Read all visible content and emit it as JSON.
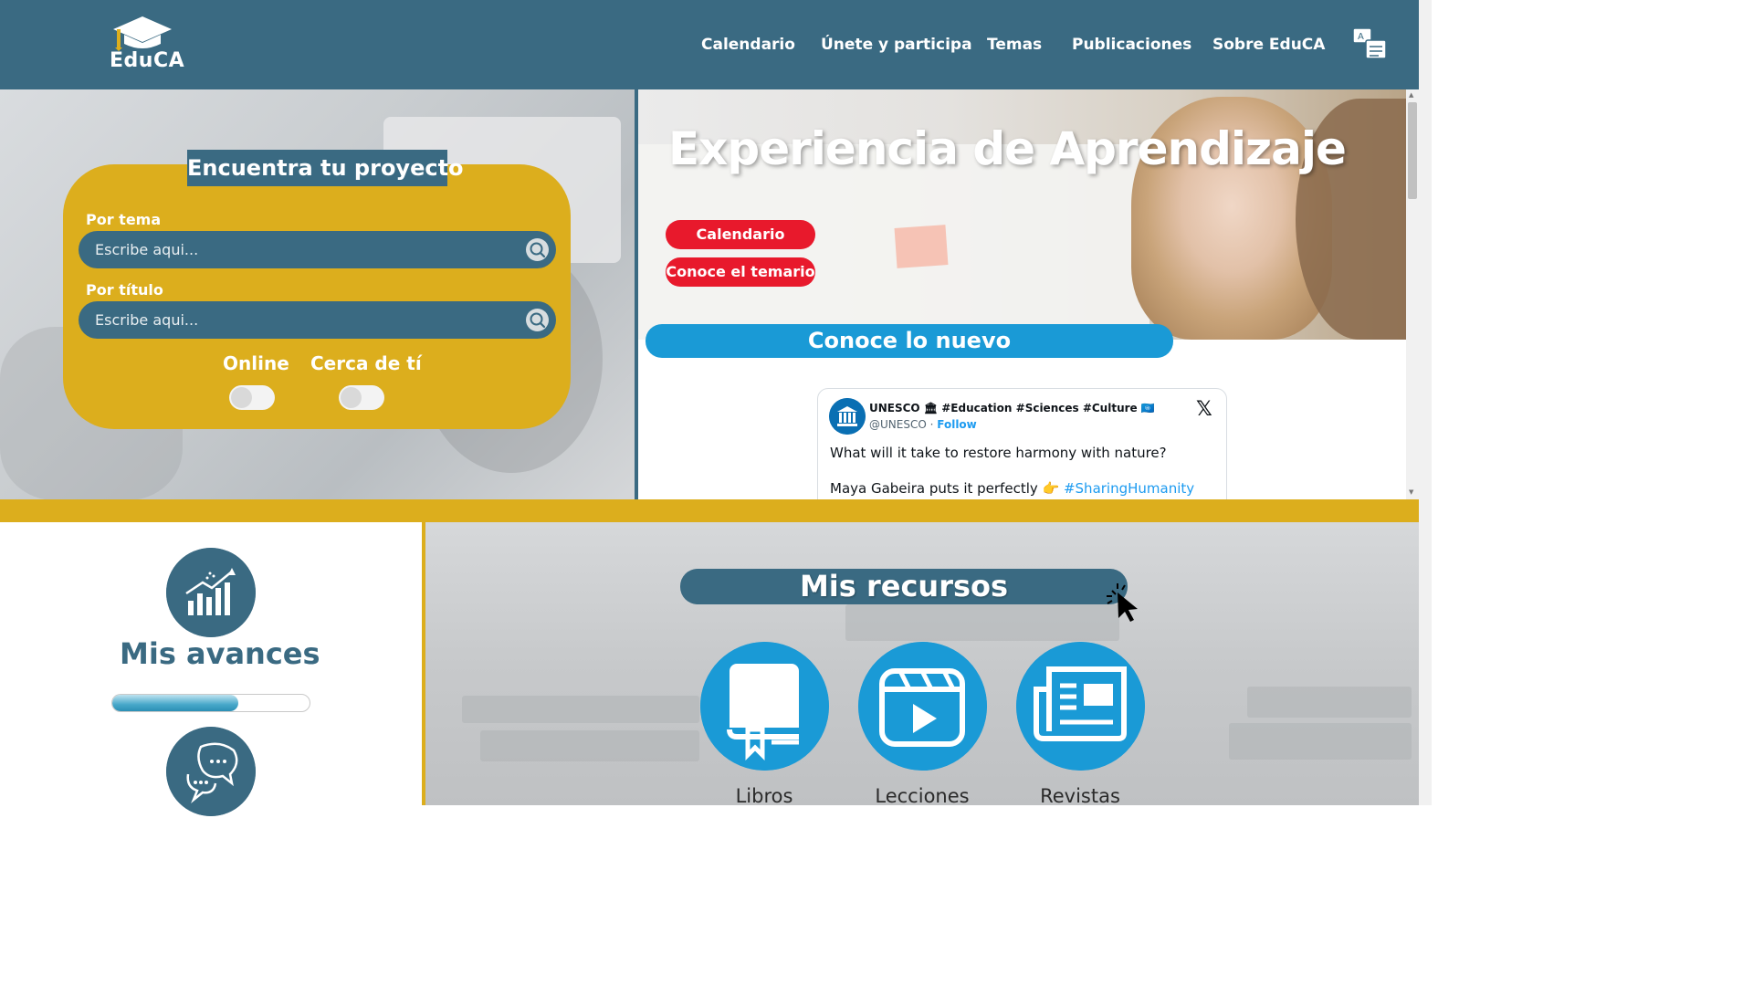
{
  "header": {
    "logo_text": "EduCA",
    "nav": [
      "Calendario",
      "Únete y participa",
      "Temas",
      "Publicaciones",
      "Sobre EduCA"
    ],
    "translate_icon": "translate-icon"
  },
  "search_card": {
    "title": "Encuentra tu proyecto",
    "topic_label": "Por tema",
    "topic_placeholder": "Escribe aqui...",
    "title_label": "Por título",
    "title_placeholder": "Escribe aqui...",
    "toggle_online": "Online",
    "toggle_near": "Cerca de tí"
  },
  "hero": {
    "title": "Experiencia de Aprendizaje",
    "btn_calendar": "Calendario",
    "btn_syllabus": "Conoce el temario"
  },
  "news": {
    "title": "Conoce lo nuevo",
    "tweet": {
      "name": "UNESCO 🏛 #Education #Sciences #Culture 🇺🇳",
      "handle": "@UNESCO",
      "follow": "Follow",
      "text_line1": "What will it take to restore harmony with nature?",
      "text_line2": "Maya Gabeira puts it perfectly 👉",
      "hashtag": "#SharingHumanity"
    }
  },
  "progress": {
    "title": "Mis avances",
    "percent": 0.64
  },
  "resources": {
    "title": "Mis recursos",
    "items": [
      "Libros",
      "Lecciones",
      "Revistas"
    ]
  },
  "colors": {
    "primary": "#3a6a82",
    "accent_yellow": "#dcae1d",
    "accent_blue": "#1a9ad6",
    "accent_red": "#e8192c"
  }
}
